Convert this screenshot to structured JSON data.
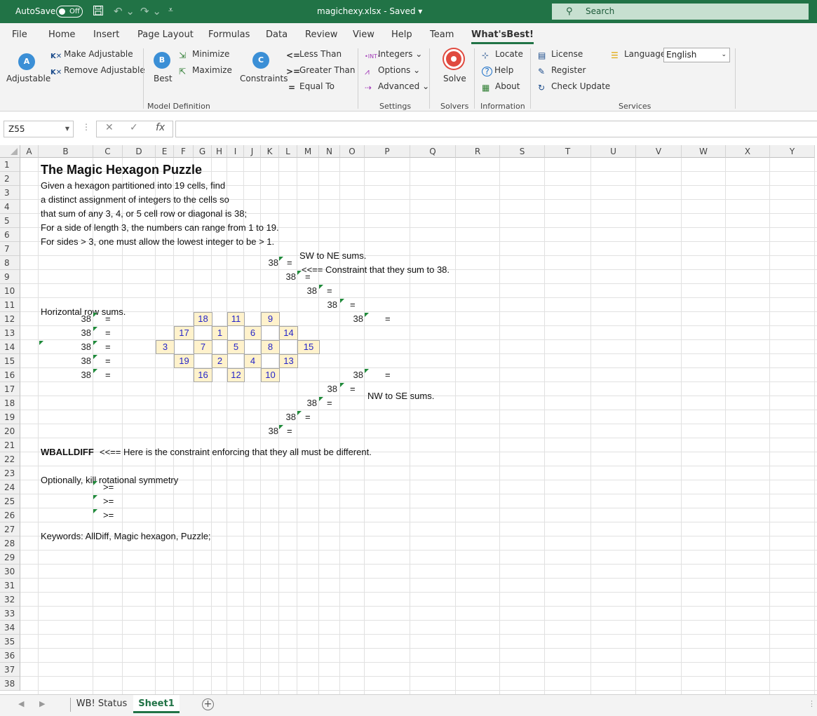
{
  "titlebar": {
    "autosave_label": "AutoSave",
    "autosave_state": "Off",
    "doc_title": "magichexy.xlsx  -  Saved  ▾",
    "search_placeholder": "Search"
  },
  "menu": {
    "tabs": [
      "File",
      "Home",
      "Insert",
      "Page Layout",
      "Formulas",
      "Data",
      "Review",
      "View",
      "Help",
      "Team",
      "What'sBest!"
    ],
    "active": "What'sBest!"
  },
  "ribbon": {
    "adjustable": "Adjustable",
    "make_adjustable": "Make Adjustable",
    "remove_adjustable": "Remove Adjustable",
    "best": "Best",
    "minimize": "Minimize",
    "maximize": "Maximize",
    "constraints": "Constraints",
    "less_than": "Less Than",
    "greater_than": "Greater Than",
    "equal_to": "Equal To",
    "integers": "Integers ⌄",
    "options": "Options ⌄",
    "advanced": "Advanced ⌄",
    "solve": "Solve",
    "locate": "Locate",
    "help": "Help",
    "about": "About",
    "license": "License",
    "register": "Register",
    "check_update": "Check Update",
    "language": "Language",
    "language_value": "English",
    "groups": {
      "model_definition": "Model Definition",
      "settings": "Settings",
      "solvers": "Solvers",
      "information": "Information",
      "services": "Services"
    }
  },
  "formula_bar": {
    "name_box": "Z55",
    "formula": ""
  },
  "sheet": {
    "columns": [
      "A",
      "B",
      "C",
      "D",
      "E",
      "F",
      "G",
      "H",
      "I",
      "J",
      "K",
      "L",
      "M",
      "N",
      "O",
      "P",
      "Q",
      "R",
      "S",
      "T",
      "U",
      "V",
      "W",
      "X",
      "Y"
    ],
    "rows": [
      "1",
      "2",
      "3",
      "4",
      "5",
      "6",
      "7",
      "8",
      "9",
      "10",
      "11",
      "12",
      "13",
      "14",
      "15",
      "16",
      "17",
      "18",
      "19",
      "20",
      "21",
      "22",
      "23",
      "24",
      "25",
      "26",
      "27",
      "28",
      "29",
      "30",
      "31",
      "32",
      "33",
      "34",
      "35",
      "36",
      "37",
      "38"
    ],
    "title": "The Magic Hexagon Puzzle",
    "desc1": "Given a hexagon partitioned into 19 cells, find",
    "desc2": "a distinct assignment of integers to the cells so",
    "desc3": "that sum of any 3, 4, or 5 cell row or diagonal is 38;",
    "desc4": "   For a side of length 3, the numbers can range from 1 to 19.",
    "desc5": "For sides > 3, one must allow the lowest integer to be > 1.",
    "sw_ne": "SW to NE sums.",
    "constraint_note": "<<== Constraint that they sum to 38.",
    "horizontal": "Horizontal row sums.",
    "nw_se": "NW to SE sums.",
    "wballdiff": "WBALLDIFF",
    "alldiff_note": "<<== Here is the constraint enforcing that they all must be different.",
    "optional": "Optionally, kill rotational symmetry",
    "keywords": "Keywords: AllDiff, Magic hexagon, Puzzle;",
    "sum": "38",
    "eq": "=",
    "ge": ">=",
    "hex_rows": [
      [
        "18",
        "11",
        "9"
      ],
      [
        "17",
        "1",
        "6",
        "14"
      ],
      [
        "3",
        "7",
        "5",
        "8",
        "15"
      ],
      [
        "19",
        "2",
        "4",
        "13"
      ],
      [
        "16",
        "12",
        "10"
      ]
    ]
  },
  "tabs": {
    "sheets": [
      "WB! Status",
      "Sheet1"
    ],
    "active": "Sheet1"
  }
}
